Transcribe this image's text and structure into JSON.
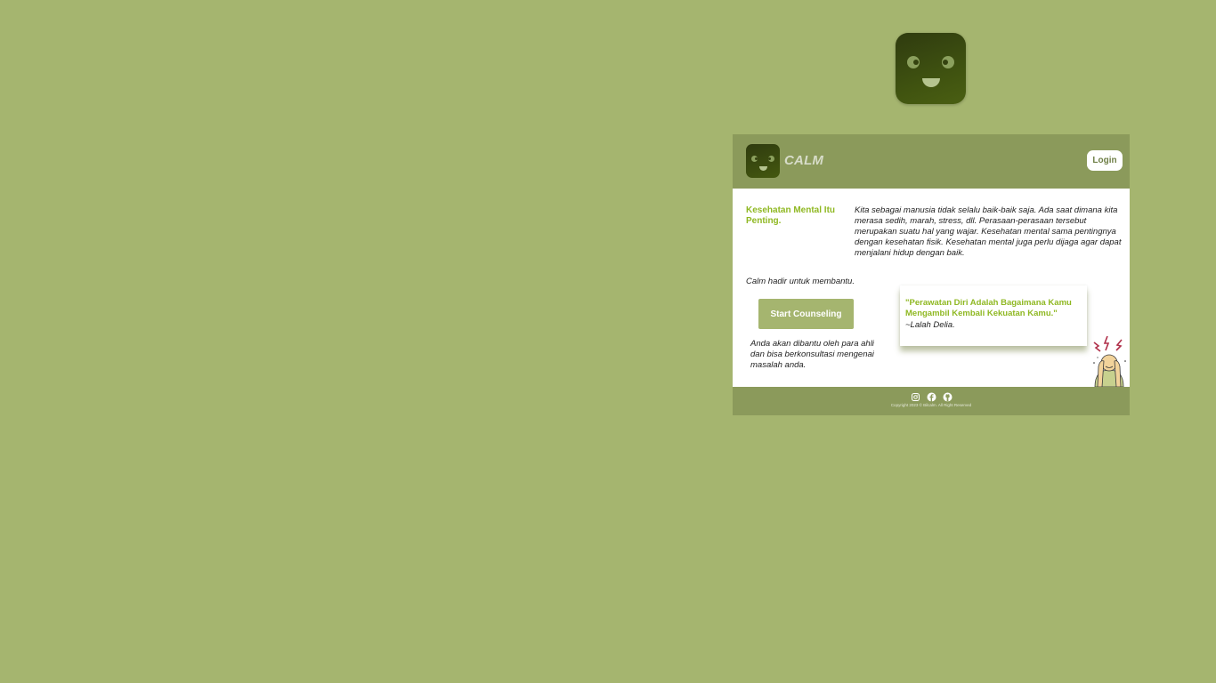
{
  "header": {
    "brand": "CALM",
    "login_label": "Login"
  },
  "main": {
    "headline": "Kesehatan Mental Itu Penting.",
    "intro": "Kita sebagai manusia tidak selalu baik-baik saja. Ada saat dimana kita merasa sedih, marah, stress, dll. Perasaan-perasaan tersebut merupakan suatu hal yang wajar. Kesehatan mental sama pentingnya dengan kesehatan fisik. Kesehatan mental juga perlu dijaga agar dapat menjalani hidup dengan baik.",
    "tagline": "Calm hadir untuk membantu.",
    "cta_label": "Start Counseling",
    "cta_description": "Anda akan dibantu oleh para ahli dan bisa berkonsultasi mengenai masalah anda.",
    "quote": "\"Perawatan Diri Adalah Bagaimana Kamu Mengambil Kembali Kekuatan Kamu.\"",
    "quote_author": "~Lalah Delia."
  },
  "footer": {
    "social_icons": [
      "instagram-icon",
      "facebook-icon",
      "github-icon"
    ],
    "copyright": "Copyright 2023 © Bilcalm. All Right Reserved"
  },
  "colors": {
    "page_background": "#a5b56f",
    "bar": "#8b9a5b",
    "accent_text": "#8fb822",
    "logo_dark": "#2f3b0f"
  }
}
